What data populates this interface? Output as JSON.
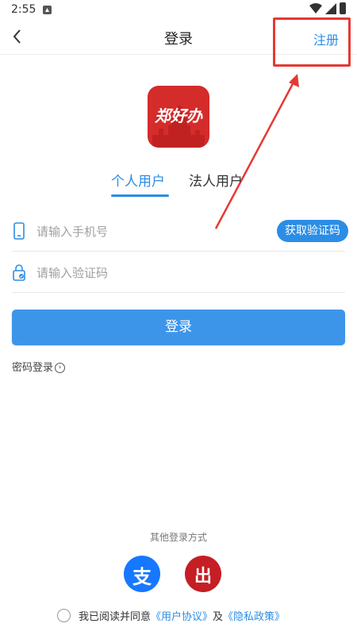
{
  "status_bar": {
    "time": "2:55"
  },
  "header": {
    "title": "登录",
    "register_label": "注册"
  },
  "logo": {
    "text": "郑好办"
  },
  "tabs": [
    {
      "label": "个人用户",
      "active": true
    },
    {
      "label": "法人用户",
      "active": false
    }
  ],
  "form": {
    "phone_placeholder": "请输入手机号",
    "code_placeholder": "请输入验证码",
    "get_code_label": "获取验证码",
    "login_label": "登录",
    "password_login_label": "密码登录"
  },
  "other_login": {
    "label": "其他登录方式",
    "alipay_glyph": "支",
    "unionpay_glyph": "出"
  },
  "agreement": {
    "prefix": "我已阅读并同意",
    "user_agreement": "《用户协议》",
    "conjunction": "及",
    "privacy_policy": "《隐私政策》"
  },
  "colors": {
    "accent": "#2b8de6",
    "login_button": "#3d95ea",
    "logo_red": "#d42b2b",
    "annotation_red": "#e53935"
  }
}
